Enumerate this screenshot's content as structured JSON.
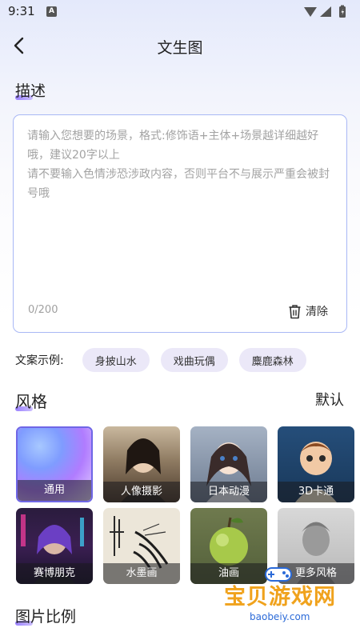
{
  "status_bar": {
    "time": "9:31",
    "notif_letter": "A"
  },
  "header": {
    "title": "文生图"
  },
  "description": {
    "title": "描述",
    "placeholder": "请输入您想要的场景，格式:修饰语+主体+场景越详细越好哦，建议20字以上\n请不要输入色情涉恐涉政内容，否则平台不与展示严重会被封号哦",
    "counter": "0/200",
    "clear_label": "清除"
  },
  "examples": {
    "label": "文案示例:",
    "chips": [
      "身披山水",
      "戏曲玩偶",
      "麋鹿森林"
    ]
  },
  "style": {
    "title": "风格",
    "default_label": "默认",
    "items": [
      {
        "label": "通用",
        "selected": true
      },
      {
        "label": "人像摄影"
      },
      {
        "label": "日本动漫"
      },
      {
        "label": "3D卡通"
      },
      {
        "label": "赛博朋克"
      },
      {
        "label": "水墨画"
      },
      {
        "label": "油画"
      },
      {
        "label": "更多风格"
      }
    ]
  },
  "ratio": {
    "title": "图片比例"
  },
  "watermark": {
    "main": "宝贝游戏网",
    "sub": "baobeiy.com"
  },
  "colors": {
    "accent": "#6f66e6",
    "chip_bg": "#ebe8f8",
    "border": "#a9b8f5"
  }
}
